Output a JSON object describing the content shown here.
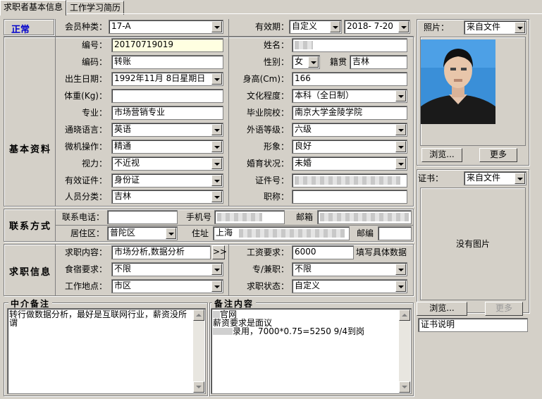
{
  "tabs": [
    "求职者基本信息",
    "工作学习简历"
  ],
  "status": "正常",
  "sections": {
    "basic": "基本资料",
    "contact": "联系方式",
    "job": "求职信息",
    "agent_notes": "中介备注",
    "notes": "备注内容"
  },
  "member_type": {
    "label": "会员种类：",
    "value": "17-A"
  },
  "validity": {
    "label": "有效期：",
    "mode": "自定义",
    "date": "2018- 7-20"
  },
  "id_no": {
    "label": "编号：",
    "value": "20170719019"
  },
  "name": {
    "label": "姓名："
  },
  "code": {
    "label": "编码：",
    "value": "转账"
  },
  "gender": {
    "label": "性别：",
    "value": "女"
  },
  "origin": {
    "label": "籍贯",
    "value": "吉林"
  },
  "birth": {
    "label": "出生日期：",
    "value": "1992年11月 8日星期日"
  },
  "height": {
    "label": "身高(Cm)：",
    "value": "166"
  },
  "weight": {
    "label": "体重(Kg)：",
    "value": ""
  },
  "education": {
    "label": "文化程度：",
    "value": "本科（全日制）"
  },
  "major": {
    "label": "专业：",
    "value": "市场营销专业"
  },
  "school": {
    "label": "毕业院校：",
    "value": "南京大学金陵学院"
  },
  "language": {
    "label": "通晓语言：",
    "value": "英语"
  },
  "foreign_level": {
    "label": "外语等级：",
    "value": "六级"
  },
  "computer": {
    "label": "微机操作：",
    "value": "精通"
  },
  "appearance": {
    "label": "形象：",
    "value": "良好"
  },
  "vision": {
    "label": "视力：",
    "value": "不近视"
  },
  "marital": {
    "label": "婚育状况：",
    "value": "未婚"
  },
  "id_type": {
    "label": "有效证件：",
    "value": "身份证"
  },
  "id_num": {
    "label": "证件号："
  },
  "category": {
    "label": "人员分类：",
    "value": "吉林"
  },
  "title": {
    "label": "职称：",
    "value": ""
  },
  "phone": {
    "label": "联系电话：",
    "value": ""
  },
  "mobile": {
    "label": "手机号"
  },
  "email": {
    "label": "邮箱"
  },
  "district": {
    "label": "居住区：",
    "value": "普陀区"
  },
  "address": {
    "label": "住址",
    "value": "上海"
  },
  "postcode": {
    "label": "邮编",
    "value": ""
  },
  "job_content": {
    "label": "求职内容：",
    "value": "市场分析,数据分析",
    "more": ">>"
  },
  "salary": {
    "label": "工资要求：",
    "value": "6000",
    "hint": "填写具体数据"
  },
  "accommodation": {
    "label": "食宿要求：",
    "value": "不限"
  },
  "work_type": {
    "label": "专/兼职：",
    "value": "不限"
  },
  "location": {
    "label": "工作地点：",
    "value": "市区"
  },
  "job_status": {
    "label": "求职状态：",
    "value": "自定义"
  },
  "agent_note_text": {
    "line1": "转行做数据分析，最好是互联网行业，薪资没所",
    "line2": "谓"
  },
  "note_text": {
    "line1": "官网",
    "line2": "薪资要求是面议",
    "line3": "录用，7000*0.75=5250  9/4到岗"
  },
  "photo": {
    "label": "照片：",
    "source": "来自文件",
    "browse": "浏览...",
    "more": "更多"
  },
  "cert": {
    "label": "证书：",
    "source": "来自文件",
    "empty": "没有图片",
    "browse": "浏览...",
    "more": "更多",
    "desc": "证书说明"
  }
}
